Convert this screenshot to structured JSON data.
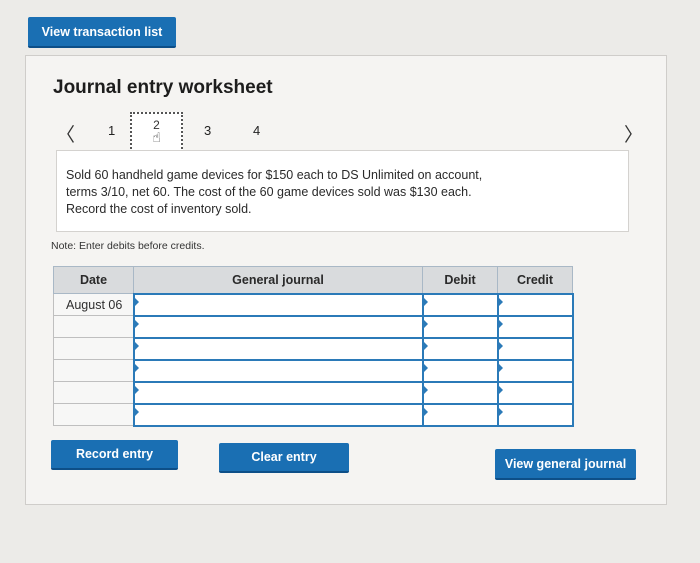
{
  "header": {
    "view_transaction_list": "View transaction list"
  },
  "worksheet": {
    "title": "Journal entry worksheet",
    "pager": {
      "prev_icon": "chevron-left-icon",
      "next_icon": "chevron-right-icon",
      "pages": [
        "1",
        "2",
        "3",
        "4"
      ],
      "current_page": "2",
      "current_page_icon": "hand-pointer-icon"
    },
    "description_lines": [
      "Sold 60 handheld game devices for $150 each to DS Unlimited on account,",
      "terms 3/10, net 60. The cost of the 60 game devices sold was $130 each.",
      "Record the cost of inventory sold."
    ],
    "note": "Note: Enter debits before credits.",
    "table": {
      "headers": [
        "Date",
        "General journal",
        "Debit",
        "Credit"
      ],
      "rows": [
        {
          "date": "August 06",
          "general_journal": "",
          "debit": "",
          "credit": ""
        },
        {
          "date": "",
          "general_journal": "",
          "debit": "",
          "credit": ""
        },
        {
          "date": "",
          "general_journal": "",
          "debit": "",
          "credit": ""
        },
        {
          "date": "",
          "general_journal": "",
          "debit": "",
          "credit": ""
        },
        {
          "date": "",
          "general_journal": "",
          "debit": "",
          "credit": ""
        },
        {
          "date": "",
          "general_journal": "",
          "debit": "",
          "credit": ""
        }
      ]
    },
    "buttons": {
      "record_entry": "Record entry",
      "clear_entry": "Clear entry",
      "view_general_journal": "View general journal"
    }
  },
  "colors": {
    "accent_blue": "#1a6fb3",
    "input_border": "#2b7ab8",
    "background": "#ecebe8"
  }
}
